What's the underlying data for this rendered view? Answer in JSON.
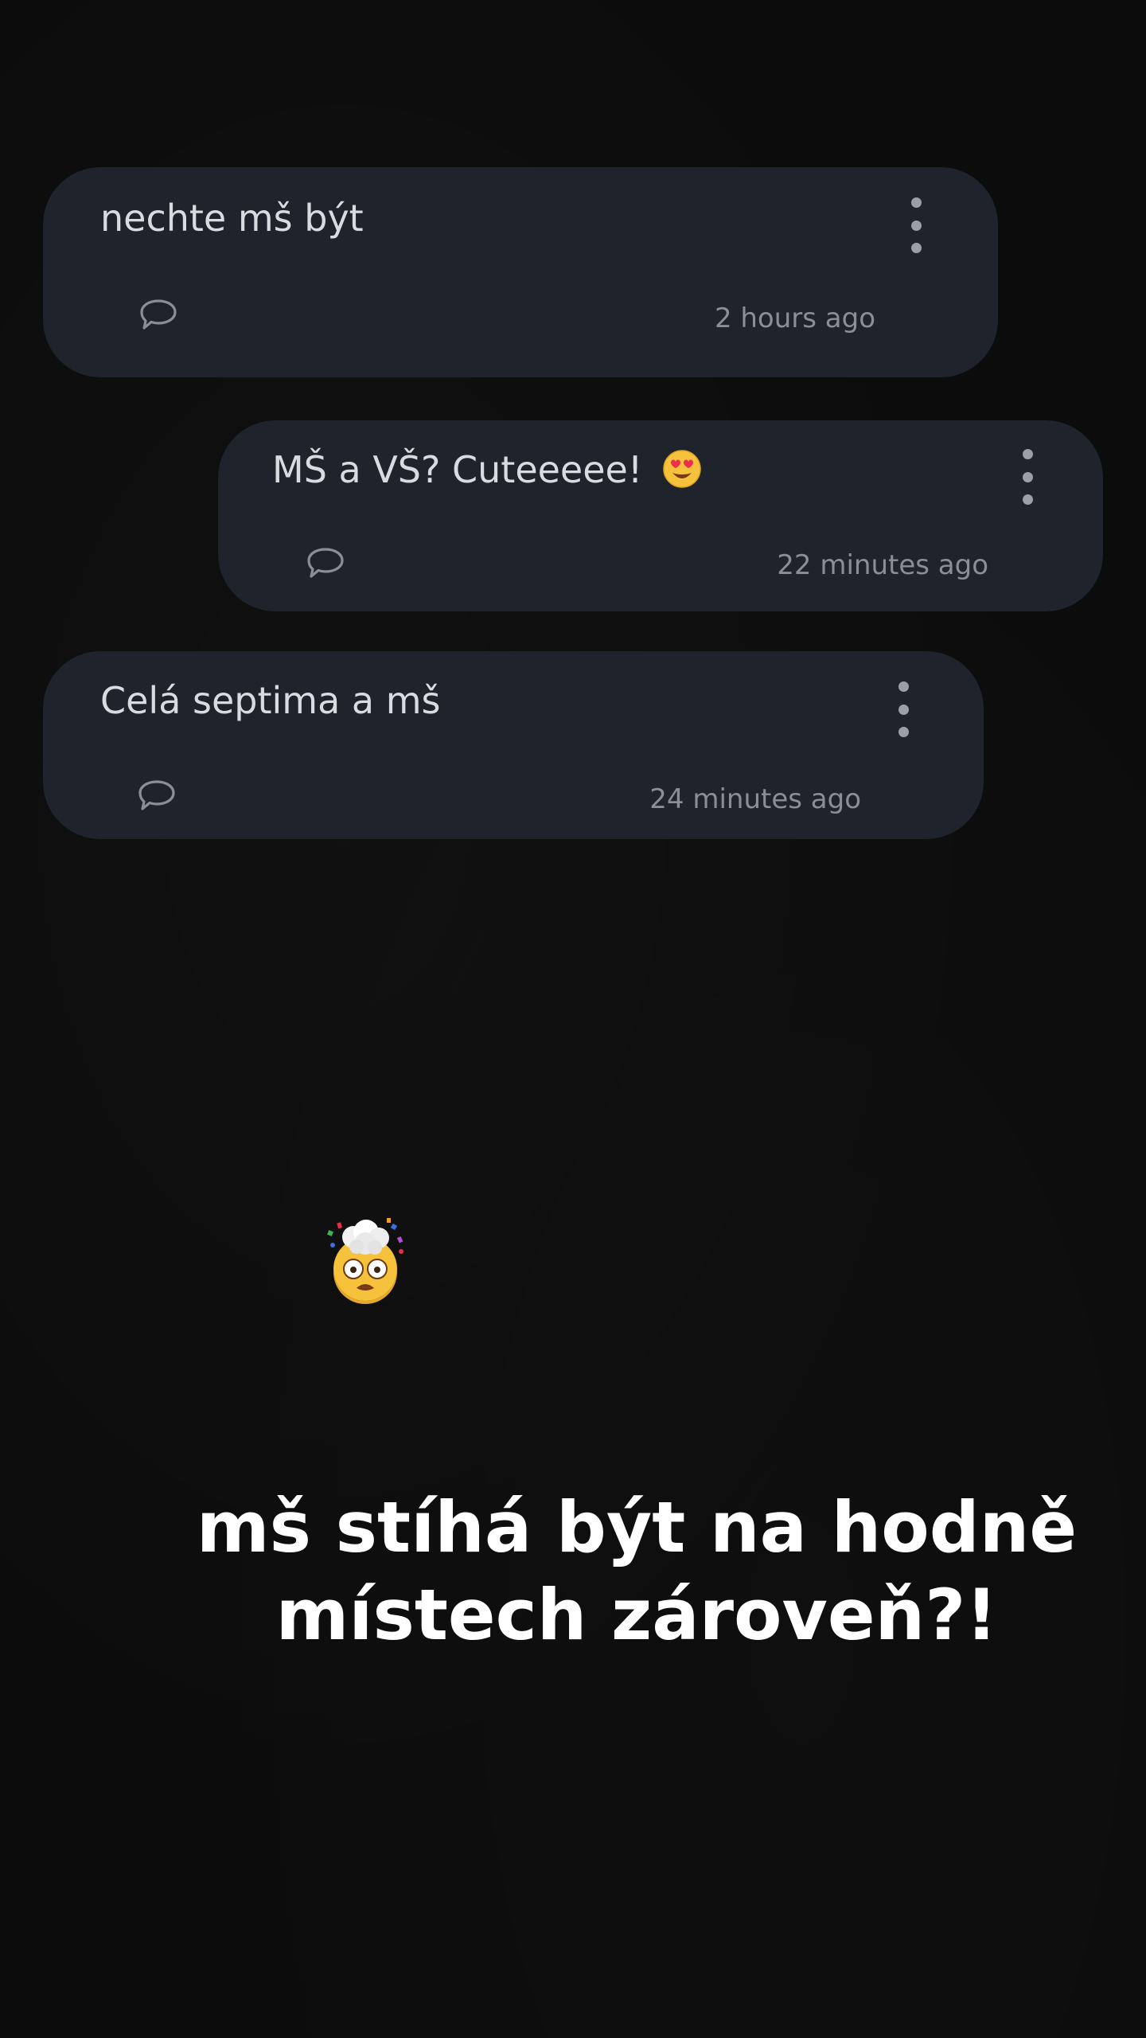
{
  "comments": [
    {
      "text": "nechte mš být",
      "timestamp": "2 hours ago",
      "has_emoji": false
    },
    {
      "text": "MŠ a VŠ? Cuteeeee!",
      "timestamp": "22 minutes ago",
      "has_emoji": true,
      "emoji": "smiling-face-with-heart-eyes"
    },
    {
      "text": "Celá septima a mš",
      "timestamp": "24 minutes ago",
      "has_emoji": false
    }
  ],
  "sticker": {
    "icon": "exploding-head-emoji"
  },
  "caption": {
    "line1": "mš stíhá být na hodně",
    "line2": "místech zároveň?!"
  },
  "colors": {
    "background": "#0c0c0c",
    "card": "#1e232c",
    "card_text": "#d8dbe0",
    "timestamp": "#8a8f97",
    "caption": "#ffffff"
  }
}
